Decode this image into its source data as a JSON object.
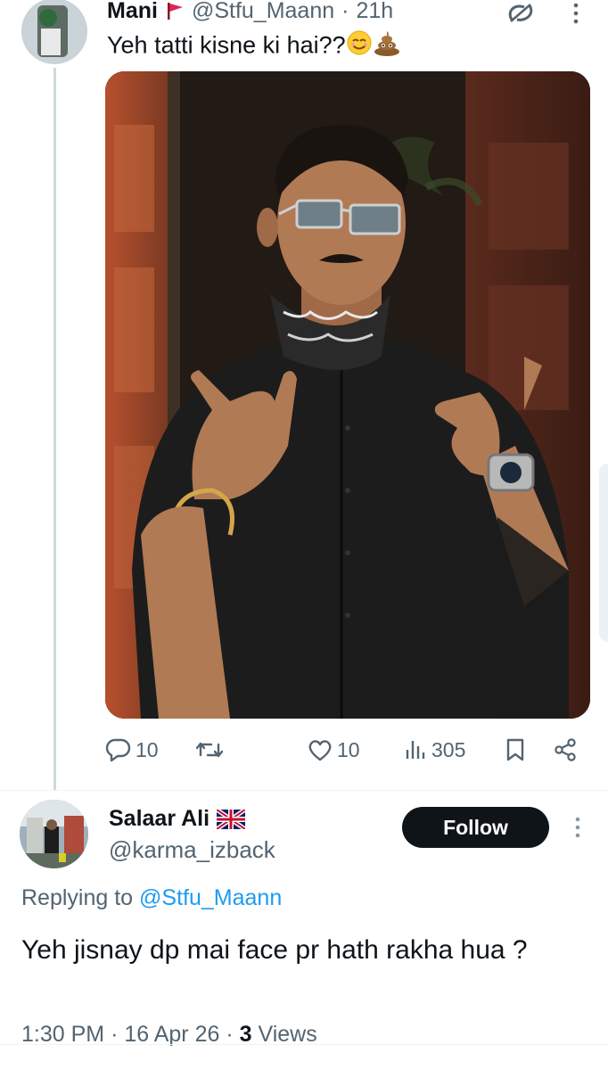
{
  "tweet": {
    "author_name": "Mani",
    "author_flag": "red-flag",
    "handle": "@Stfu_Maann",
    "separator": "·",
    "time": "21h",
    "text": "Yeh tatti kisne ki hai??",
    "text_emojis": [
      "smiling-face-icon",
      "pile-of-poo-icon"
    ],
    "image_alt": "Man in black shirt and sunglasses with bandana making hand gestures",
    "actions": {
      "replies": "10",
      "retweets": "",
      "likes": "10",
      "views": "305"
    }
  },
  "reply": {
    "author_name": "Salaar Ali",
    "author_flag": "uk-flag-icon",
    "handle": "@karma_izback",
    "follow_label": "Follow",
    "replying_prefix": "Replying to",
    "replying_to": "@Stfu_Maann",
    "text": "Yeh jisnay dp mai face pr hath rakha hua ?",
    "time": "1:30 PM",
    "date": "16 Apr 26",
    "views_count": "3",
    "views_label": "Views",
    "meta_separator": "·"
  },
  "colors": {
    "text": "#0f1419",
    "secondary": "#536471",
    "link": "#1d9bf0",
    "button_bg": "#0f1419",
    "flag_red": "#e0245e"
  }
}
